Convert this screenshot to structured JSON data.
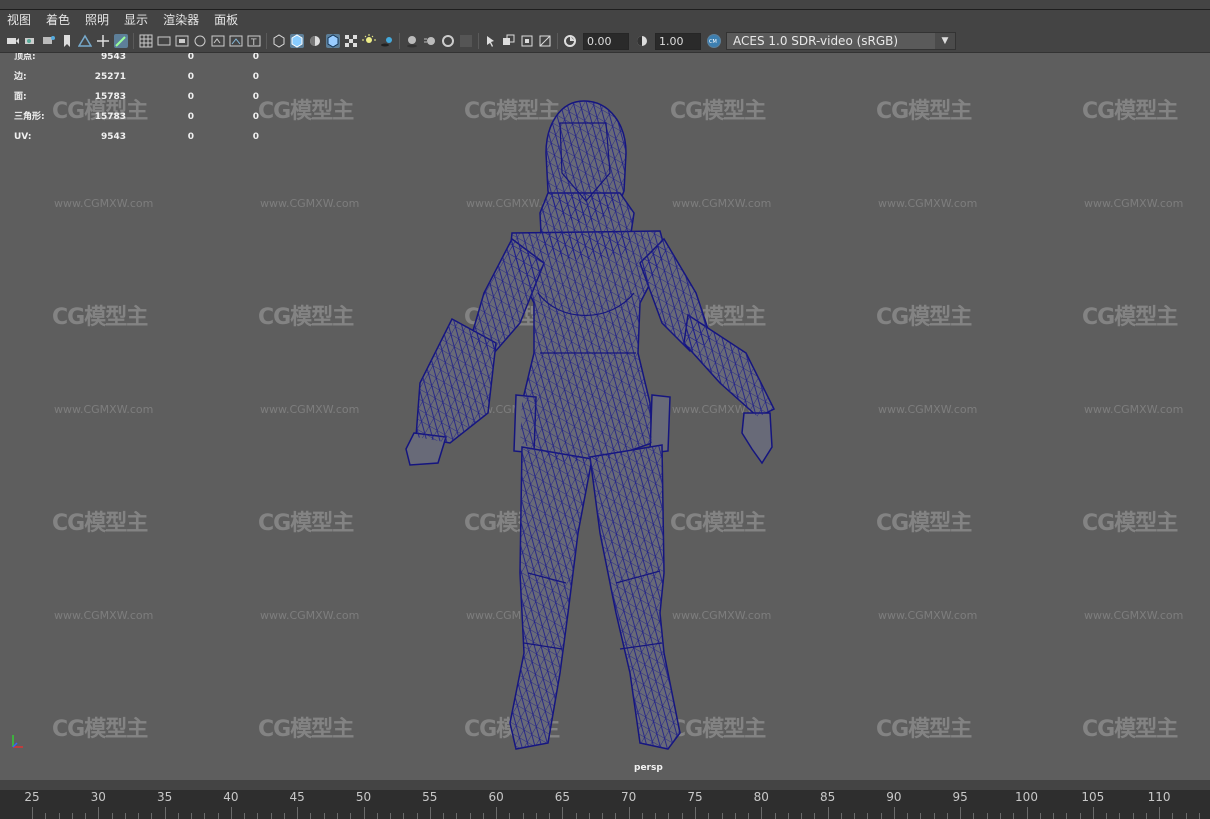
{
  "menu": [
    "视图",
    "着色",
    "照明",
    "显示",
    "渲染器",
    "面板"
  ],
  "toolbar": {
    "gamma_value": "0.00",
    "exposure_value": "1.00",
    "color_space": "ACES 1.0 SDR-video (sRGB)"
  },
  "hud": {
    "rows": [
      {
        "label": "顶点:",
        "v1": "9543",
        "v2": "0",
        "v3": "0"
      },
      {
        "label": "边:",
        "v1": "25271",
        "v2": "0",
        "v3": "0"
      },
      {
        "label": "面:",
        "v1": "15783",
        "v2": "0",
        "v3": "0"
      },
      {
        "label": "三角形:",
        "v1": "15783",
        "v2": "0",
        "v3": "0"
      },
      {
        "label": "UV:",
        "v1": "9543",
        "v2": "0",
        "v3": "0"
      }
    ]
  },
  "viewport": {
    "camera": "persp",
    "watermark_logo": "CG模型主",
    "watermark_url": "www.CGMXW.com"
  },
  "timeline": {
    "ticks": [
      "25",
      "30",
      "35",
      "40",
      "45",
      "50",
      "55",
      "60",
      "65",
      "70",
      "75",
      "80",
      "85",
      "90",
      "95",
      "100",
      "105",
      "110"
    ]
  },
  "colors": {
    "viewport_bg": "#5e5e5e",
    "wireframe": "#1a1a8c",
    "active_tool": "#5d7f99"
  }
}
